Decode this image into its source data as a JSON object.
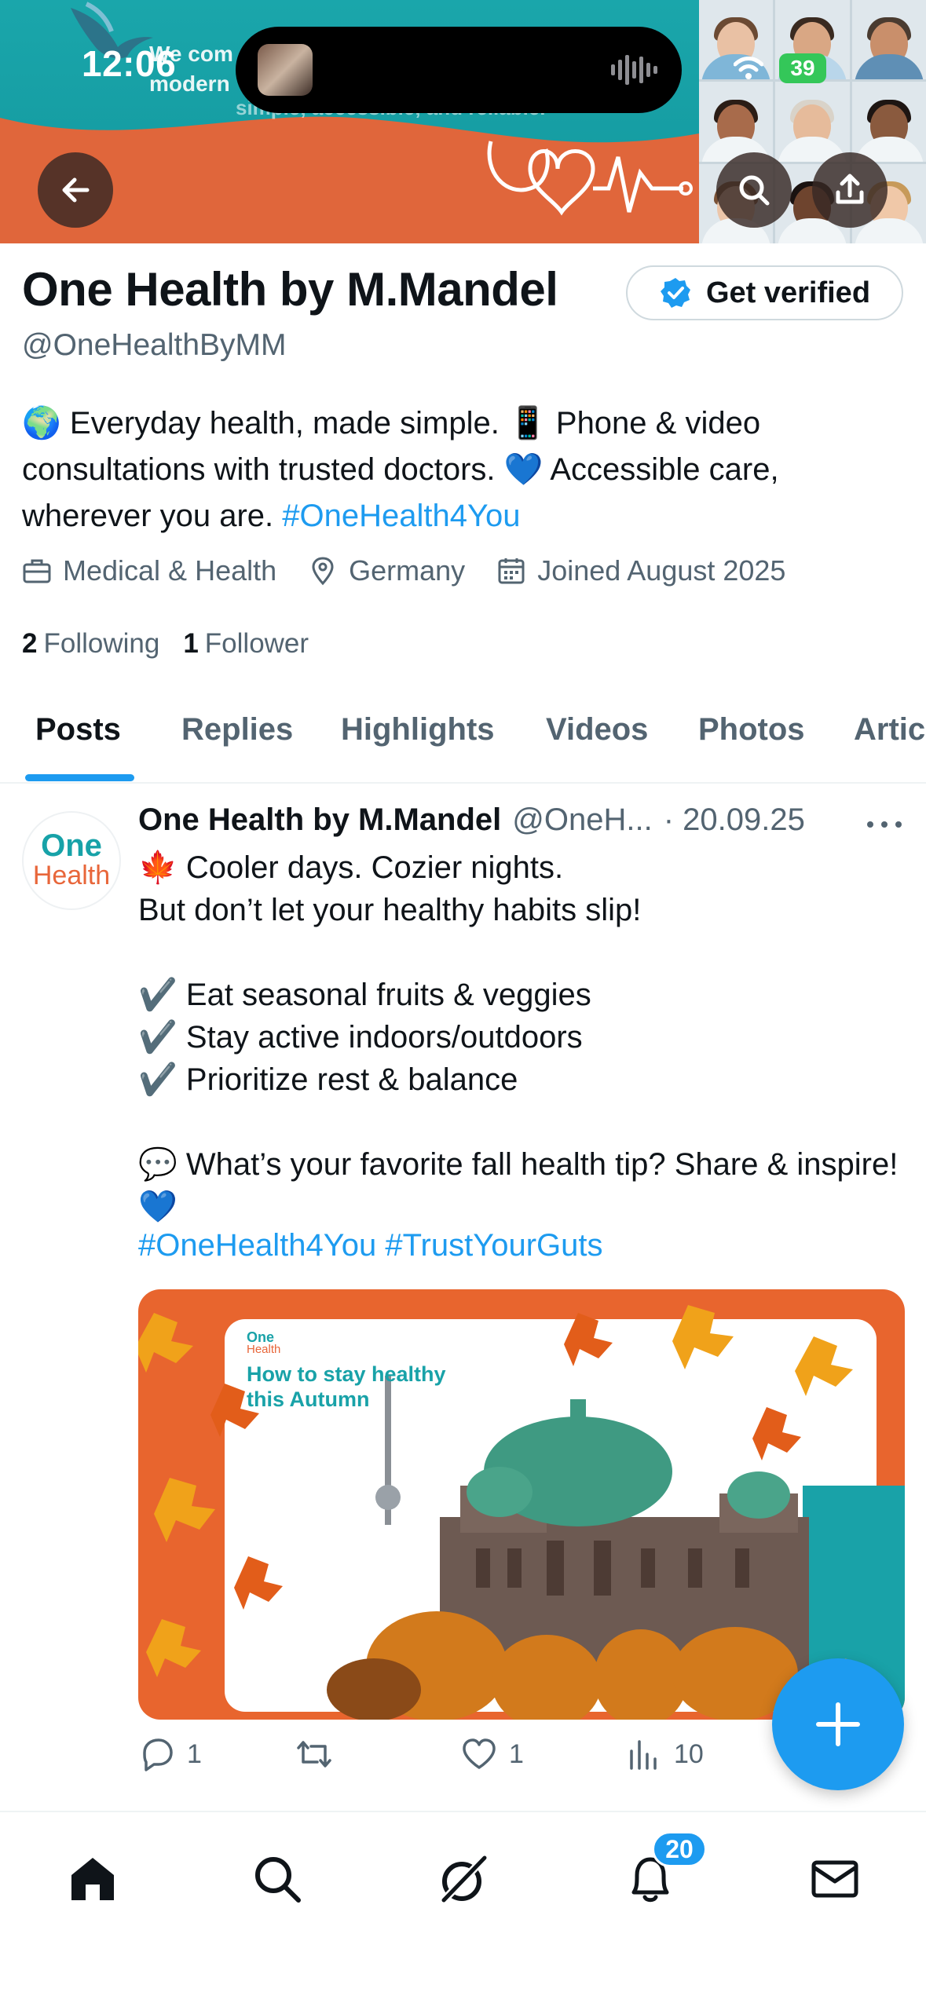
{
  "status_bar": {
    "time": "12:06",
    "battery": "39"
  },
  "banner": {
    "headline_line1": "We com",
    "headline_line2": "modern",
    "tagline": "simple, accessible, and reliable."
  },
  "profile": {
    "name": "One Health by M.Mandel",
    "verify_label": "Get verified",
    "handle": "@OneHealthByMM",
    "bio_text": "🌍 Everyday health, made simple. 📱 Phone & video consultations with trusted doctors. 💙 Accessible care, wherever you are. ",
    "bio_hashtag": "#OneHealth4You",
    "category": "Medical & Health",
    "location": "Germany",
    "joined": "Joined August 2025",
    "following_count": "2",
    "following_label": "Following",
    "followers_count": "1",
    "followers_label": "Follower"
  },
  "tabs": [
    "Posts",
    "Replies",
    "Highlights",
    "Videos",
    "Photos",
    "Artic"
  ],
  "post": {
    "avatar_line1": "One",
    "avatar_line2": "Health",
    "author": "One Health by M.Mandel",
    "handle": "@OneH...",
    "date": "· 20.09.25",
    "text": "🍁 Cooler days. Cozier nights.\nBut don’t let your healthy habits slip!\n\n✔️ Eat seasonal fruits & veggies\n✔️ Stay active indoors/outdoors\n✔️ Prioritize rest & balance\n\n💬 What’s your favorite fall health tip? Share & inspire! 💙",
    "hashtags": "#OneHealth4You #TrustYourGuts",
    "media": {
      "logo_line1": "One",
      "logo_line2": "Health",
      "title_line1": "How to stay healthy",
      "title_line2": "this Autumn"
    },
    "replies": "1",
    "reposts": "",
    "likes": "1",
    "views": "10"
  },
  "nav": {
    "notifications_badge": "20"
  },
  "colors": {
    "accent": "#1d9bf0",
    "text": "#0f1419",
    "muted": "#536471",
    "brand_teal": "#19a2a8",
    "brand_orange": "#e8652e"
  }
}
